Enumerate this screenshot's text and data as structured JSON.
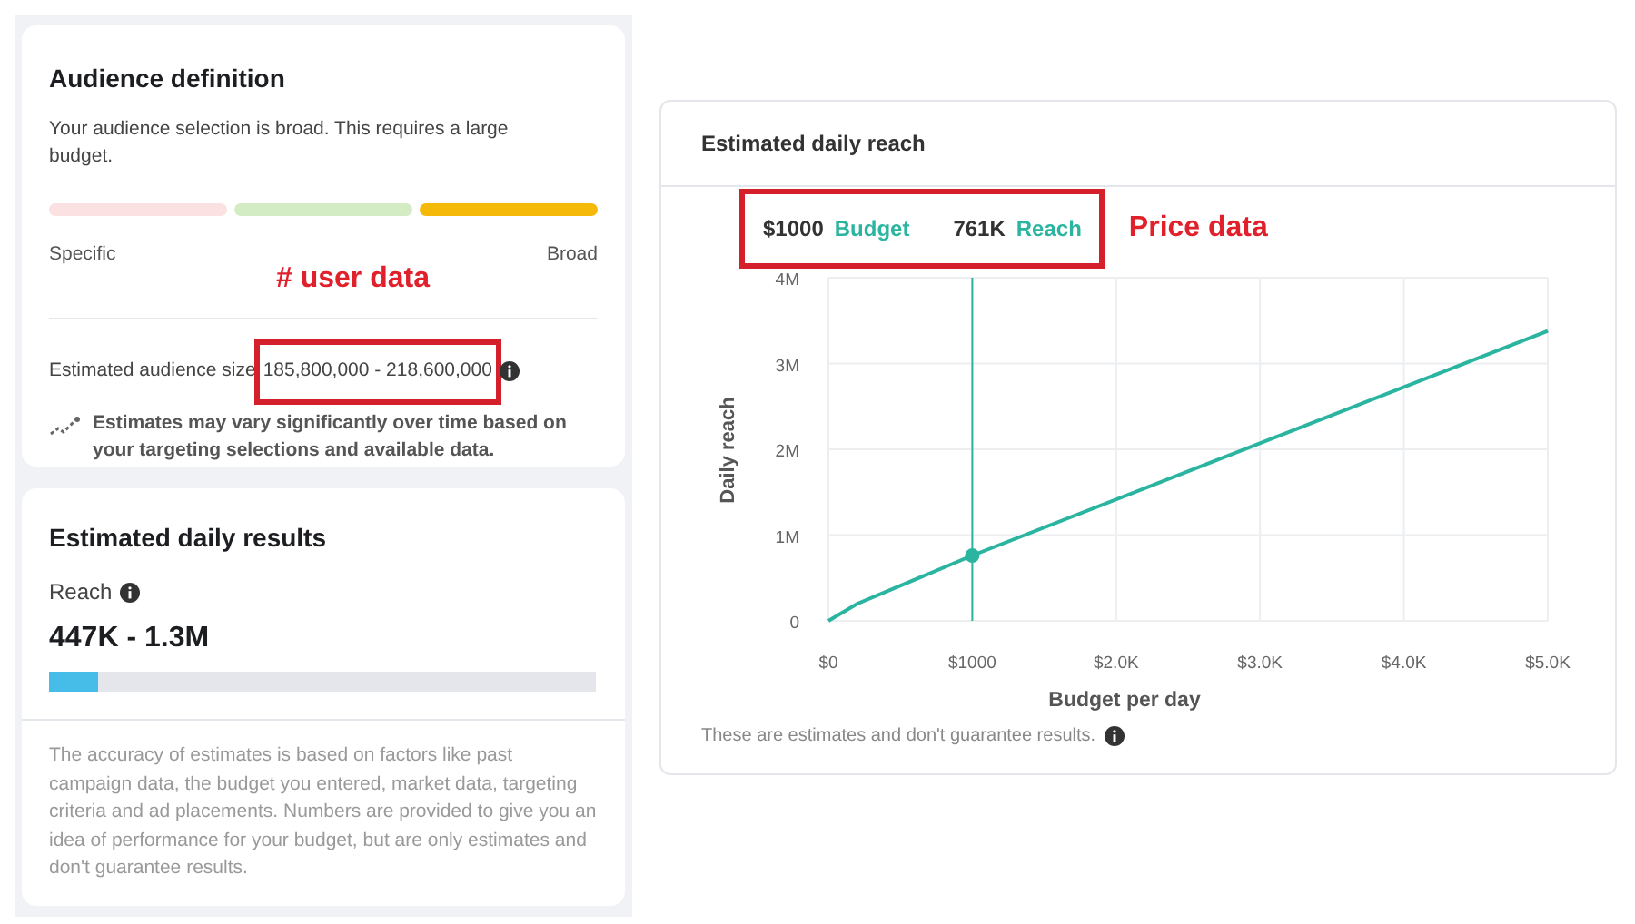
{
  "audience_card": {
    "title": "Audience definition",
    "description": "Your audience selection is broad. This requires a large budget.",
    "meter": {
      "segments": [
        {
          "color": "#fbe1e1"
        },
        {
          "color": "#d4ecc4"
        },
        {
          "color": "#f5b90a"
        }
      ],
      "start_label": "Specific",
      "end_label": "Broad"
    },
    "audience_size": {
      "label": "Estimated audience size",
      "value": "185,800,000 - 218,600,000",
      "highlighted": true,
      "annotation": "# user data"
    },
    "note": "Estimates may vary significantly over time based on your targeting selections and available data."
  },
  "results_card": {
    "title": "Estimated daily results",
    "metric": "Reach",
    "value": "447K - 1.3M",
    "level": 0.09,
    "disclaimer": "The accuracy of estimates is based on factors like past campaign data, the budget you entered, market data, targeting criteria and ad placements. Numbers are provided to give you an idea of performance for your budget, but are only estimates and don't guarantee results."
  },
  "reach_card": {
    "title": "Estimated daily reach",
    "readout": {
      "budget_value": "$1000",
      "budget_label": "Budget",
      "reach_value": "761K",
      "reach_label": "Reach",
      "highlighted": true,
      "annotation": "Price data"
    },
    "chart_data": {
      "type": "line",
      "xlabel": "Budget per day",
      "ylabel": "Daily reach",
      "x": [
        0,
        200,
        1000,
        5000
      ],
      "series": [
        {
          "color": "#2bb5a0",
          "values": [
            0,
            200000,
            761000,
            3380000
          ]
        }
      ],
      "grid": true,
      "ref_lines": [
        {
          "axis": "x",
          "value": 1000,
          "color": "#2bb5a0"
        }
      ],
      "xlim": [
        0,
        5000
      ],
      "ylim": [
        0,
        4000000
      ],
      "xticks": [
        {
          "value": 0,
          "label": "$0"
        },
        {
          "value": 1000,
          "label": "$1000"
        },
        {
          "value": 2000,
          "label": "$2.0K"
        },
        {
          "value": 3000,
          "label": "$3.0K"
        },
        {
          "value": 4000,
          "label": "$4.0K"
        },
        {
          "value": 5000,
          "label": "$5.0K"
        }
      ],
      "yticks": [
        {
          "value": 0,
          "label": "0"
        },
        {
          "value": 1000000,
          "label": "1M"
        },
        {
          "value": 2000000,
          "label": "2M"
        },
        {
          "value": 3000000,
          "label": "3M"
        },
        {
          "value": 4000000,
          "label": "4M"
        }
      ]
    },
    "footnote": "These are estimates and don't guarantee results."
  }
}
